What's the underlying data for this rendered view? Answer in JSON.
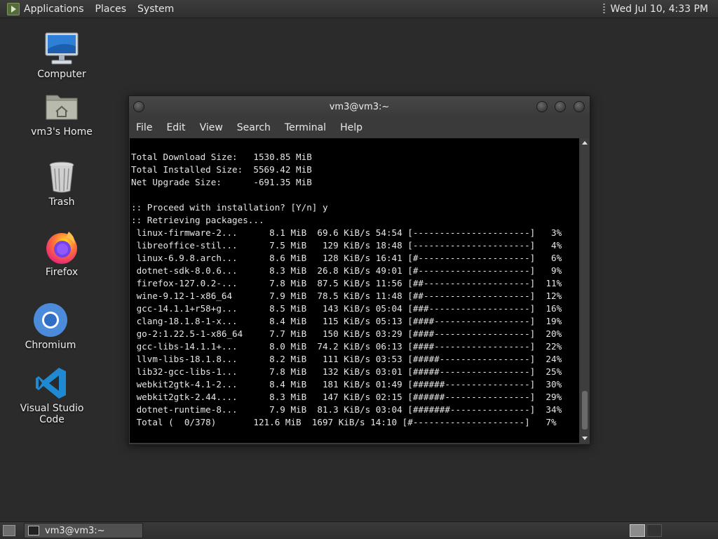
{
  "top_panel": {
    "menus": [
      "Applications",
      "Places",
      "System"
    ],
    "clock": "Wed Jul 10,  4:33 PM"
  },
  "desktop_icons": [
    {
      "label": "Computer",
      "icon": "computer-icon"
    },
    {
      "label": "vm3's Home",
      "icon": "home-folder-icon"
    },
    {
      "label": "Trash",
      "icon": "trash-icon"
    },
    {
      "label": "Firefox",
      "icon": "firefox-icon"
    },
    {
      "label": "Chromium",
      "icon": "chromium-icon"
    },
    {
      "label": "Visual Studio Code",
      "icon": "vscode-icon"
    }
  ],
  "terminal": {
    "title": "vm3@vm3:~",
    "menu": [
      "File",
      "Edit",
      "View",
      "Search",
      "Terminal",
      "Help"
    ],
    "lines": [
      "Total Download Size:   1530.85 MiB",
      "Total Installed Size:  5569.42 MiB",
      "Net Upgrade Size:      -691.35 MiB",
      "",
      ":: Proceed with installation? [Y/n] y",
      ":: Retrieving packages...",
      " linux-firmware-2...      8.1 MiB  69.6 KiB/s 54:54 [----------------------]   3%",
      " libreoffice-stil...      7.5 MiB   129 KiB/s 18:48 [----------------------]   4%",
      " linux-6.9.8.arch...      8.6 MiB   128 KiB/s 16:41 [#---------------------]   6%",
      " dotnet-sdk-8.0.6...      8.3 MiB  26.8 KiB/s 49:01 [#---------------------]   9%",
      " firefox-127.0.2-...      7.8 MiB  87.5 KiB/s 11:56 [##--------------------]  11%",
      " wine-9.12-1-x86_64       7.9 MiB  78.5 KiB/s 11:48 [##--------------------]  12%",
      " gcc-14.1.1+r58+g...      8.5 MiB   143 KiB/s 05:04 [###-------------------]  16%",
      " clang-18.1.8-1-x...      8.4 MiB   115 KiB/s 05:13 [####------------------]  19%",
      " go-2:1.22.5-1-x86_64     7.7 MiB   150 KiB/s 03:29 [####------------------]  20%",
      " gcc-libs-14.1.1+...      8.0 MiB  74.2 KiB/s 06:13 [####------------------]  22%",
      " llvm-libs-18.1.8...      8.2 MiB   111 KiB/s 03:53 [#####-----------------]  24%",
      " lib32-gcc-libs-1...      7.8 MiB   132 KiB/s 03:01 [#####-----------------]  25%",
      " webkit2gtk-4.1-2...      8.4 MiB   181 KiB/s 01:49 [######----------------]  30%",
      " webkit2gtk-2.44....      8.3 MiB   147 KiB/s 02:15 [######----------------]  29%",
      " dotnet-runtime-8...      7.9 MiB  81.3 KiB/s 03:04 [#######---------------]  34%",
      " Total (  0/378)       121.6 MiB  1697 KiB/s 14:10 [#---------------------]   7%"
    ]
  },
  "taskbar": {
    "task_label": "vm3@vm3:~"
  }
}
